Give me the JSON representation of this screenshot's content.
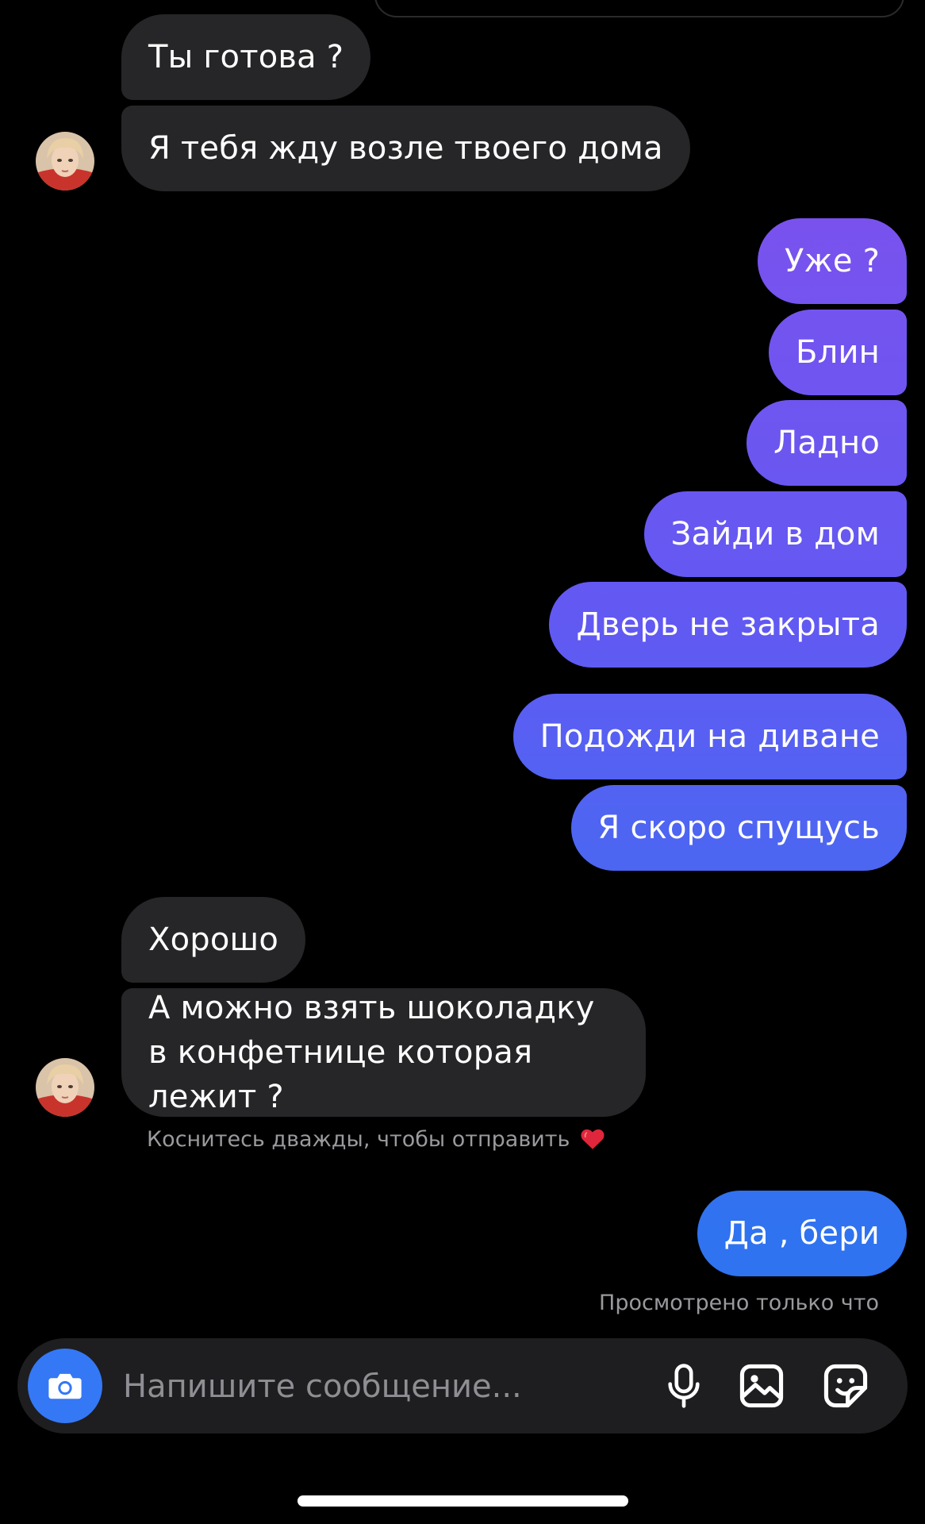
{
  "conversation": {
    "received_group_1": [
      {
        "text": "Ты готова ?"
      },
      {
        "text": "Я тебя жду возле твоего дома"
      }
    ],
    "sent_group_1": [
      {
        "text": "Уже ?"
      },
      {
        "text": "Блин"
      },
      {
        "text": "Ладно"
      },
      {
        "text": "Зайди в дом"
      },
      {
        "text": "Дверь не закрыта"
      }
    ],
    "sent_group_2": [
      {
        "text": "Подожди на диване"
      },
      {
        "text": "Я скоро спущусь"
      }
    ],
    "received_group_2": [
      {
        "text": "Хорошо"
      },
      {
        "text": "А можно взять шоколадку в конфетнице которая лежит ?"
      }
    ],
    "double_tap_hint": "Коснитесь дважды, чтобы отправить",
    "sent_group_3": [
      {
        "text": "Да , бери"
      }
    ],
    "seen_status": "Просмотрено только что"
  },
  "composer": {
    "placeholder": "Напишите сообщение...",
    "icons": [
      "camera-icon",
      "microphone-icon",
      "gallery-icon",
      "sticker-icon"
    ]
  },
  "colors": {
    "background": "#000000",
    "received_bubble": "#262628",
    "sent_gradient_top": "#8a4af0",
    "sent_gradient_bottom": "#2f73f0",
    "camera_button": "#3478f6",
    "heart": "#e0263b"
  }
}
